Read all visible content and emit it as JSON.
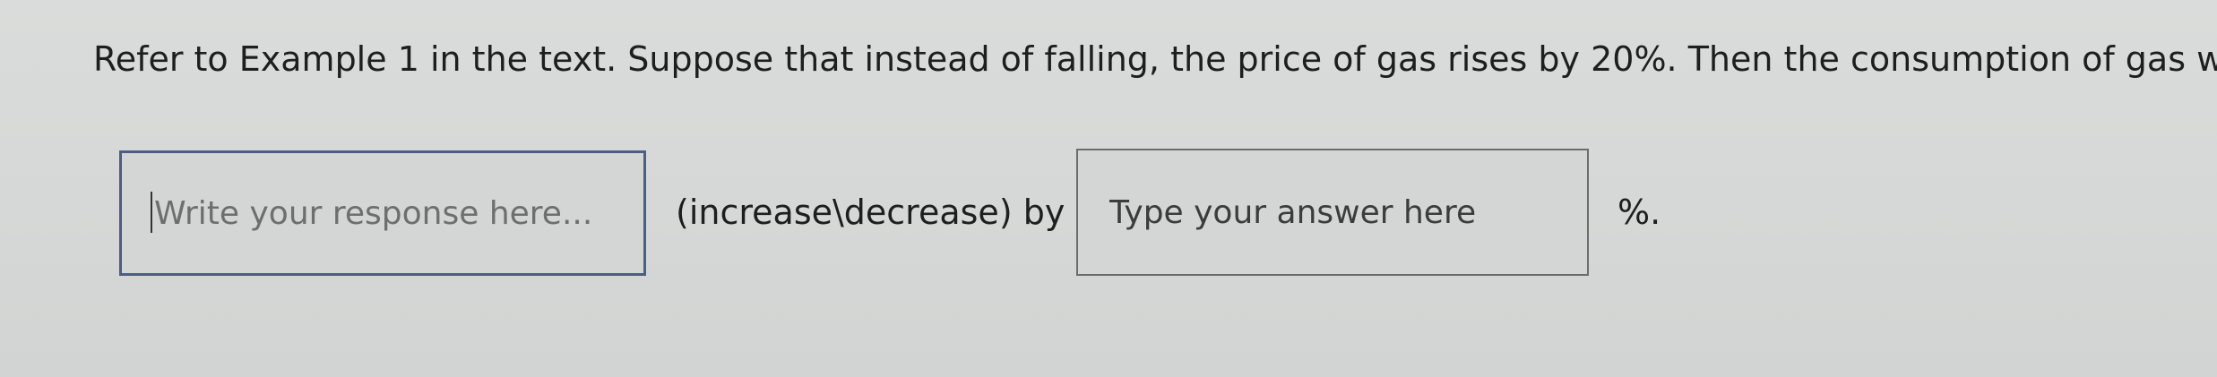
{
  "question": {
    "text": "Refer to Example 1 in the text. Suppose that instead of falling, the price of gas rises by 20%. Then the consumption of gas will"
  },
  "response_field": {
    "value": "",
    "placeholder": "Write your response here..."
  },
  "direction_label": "(increase\\decrease) by",
  "answer_field": {
    "value": "",
    "placeholder": "Type your answer here"
  },
  "unit_label": "%."
}
